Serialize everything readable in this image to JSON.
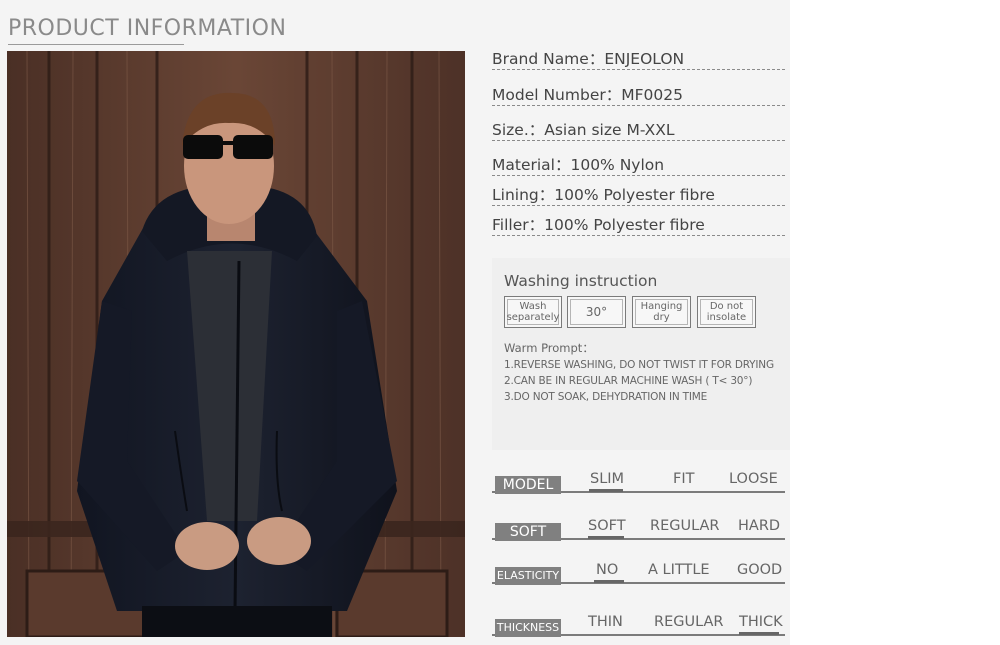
{
  "header": {
    "title": "PRODUCT INFORMATION"
  },
  "photo": {
    "description": "product-photo-man-wearing-jacket"
  },
  "specs": [
    {
      "label": "Brand Name",
      "value": "ENJEOLON"
    },
    {
      "label": "Model Number",
      "value": "MF0025"
    },
    {
      "label": "Size.",
      "value": "Asian size M-XXL"
    },
    {
      "label": "Material",
      "value": "100% Nylon"
    },
    {
      "label": "Lining",
      "value": "100% Polyester fibre"
    },
    {
      "label": "Filler",
      "value": "100% Polyester fibre"
    }
  ],
  "spec_rows_text": [
    "Brand Name：ENJEOLON",
    "Model Number：MF0025",
    "Size.：Asian size M-XXL",
    "Material：100% Nylon",
    "Lining：100% Polyester fibre",
    "Filler：100% Polyester fibre"
  ],
  "washing": {
    "title": "Washing instruction",
    "boxes": [
      "Wash separately",
      "30°",
      "Hanging dry",
      "Do not insolate"
    ],
    "prompt_title": "Warm Prompt：",
    "prompts": [
      "1.REVERSE WASHING, DO NOT TWIST IT FOR DRYING",
      "2.CAN BE IN REGULAR MACHINE WASH ( T< 30°)",
      "3.DO NOT SOAK, DEHYDRATION IN TIME"
    ]
  },
  "scales": [
    {
      "label": "MODEL",
      "options": [
        "SLIM",
        "FIT",
        "LOOSE"
      ],
      "selected": "SLIM"
    },
    {
      "label": "SOFT",
      "options": [
        "SOFT",
        "REGULAR",
        "HARD"
      ],
      "selected": "SOFT"
    },
    {
      "label": "ELASTICITY",
      "options": [
        "NO",
        "A LITTLE",
        "GOOD"
      ],
      "selected": "NO"
    },
    {
      "label": "THICKNESS",
      "options": [
        "THIN",
        "REGULAR",
        "THICK"
      ],
      "selected": "THICK"
    }
  ],
  "colors": {
    "panel": "#f4f4f4",
    "tag": "#808080",
    "header": "#8a8a8a"
  }
}
